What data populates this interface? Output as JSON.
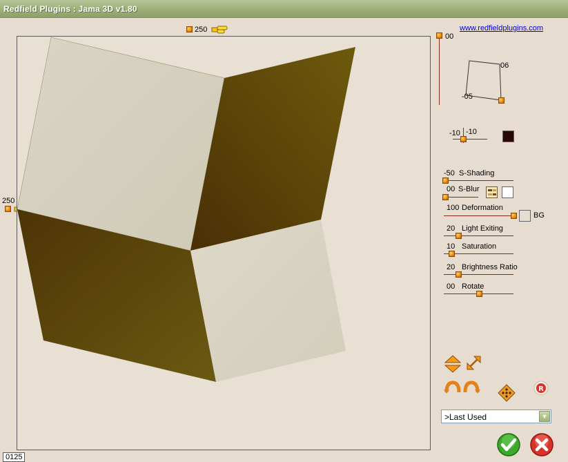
{
  "window": {
    "title": "Redfield Plugins : Jama 3D  v1.80"
  },
  "link": "www.redfieldplugins.com",
  "preview": {
    "top_value": "250",
    "left_value": "250",
    "counter": "0125"
  },
  "vertical_slider": {
    "value": "00"
  },
  "perspective": {
    "value_a": "06",
    "value_b": "-05"
  },
  "position": {
    "x": "-10",
    "y": "-10",
    "color": "#2a0606"
  },
  "sliders": {
    "shading": {
      "value": "-50",
      "label": "S-Shading"
    },
    "blur": {
      "value": "00",
      "label": "S-Blur"
    },
    "deformation": {
      "value": "100",
      "label": "Deformation"
    },
    "light": {
      "value": "20",
      "label": "Light Exiting"
    },
    "saturation": {
      "value": "10",
      "label": "Saturation"
    },
    "brightness": {
      "value": "20",
      "label": "Brightness Ratio"
    },
    "rotate": {
      "value": "00",
      "label": "Rotate"
    }
  },
  "bg_label": "BG",
  "preset": {
    "selected": ">Last Used"
  },
  "colors": {
    "title_bar": "#9eb07a",
    "accent": "#f39a1a",
    "link": "#0000cc",
    "cube_light": "#d6d2bf",
    "cube_dark": "#5a420a",
    "ok": "#3ea82a",
    "cancel": "#d8322a"
  }
}
